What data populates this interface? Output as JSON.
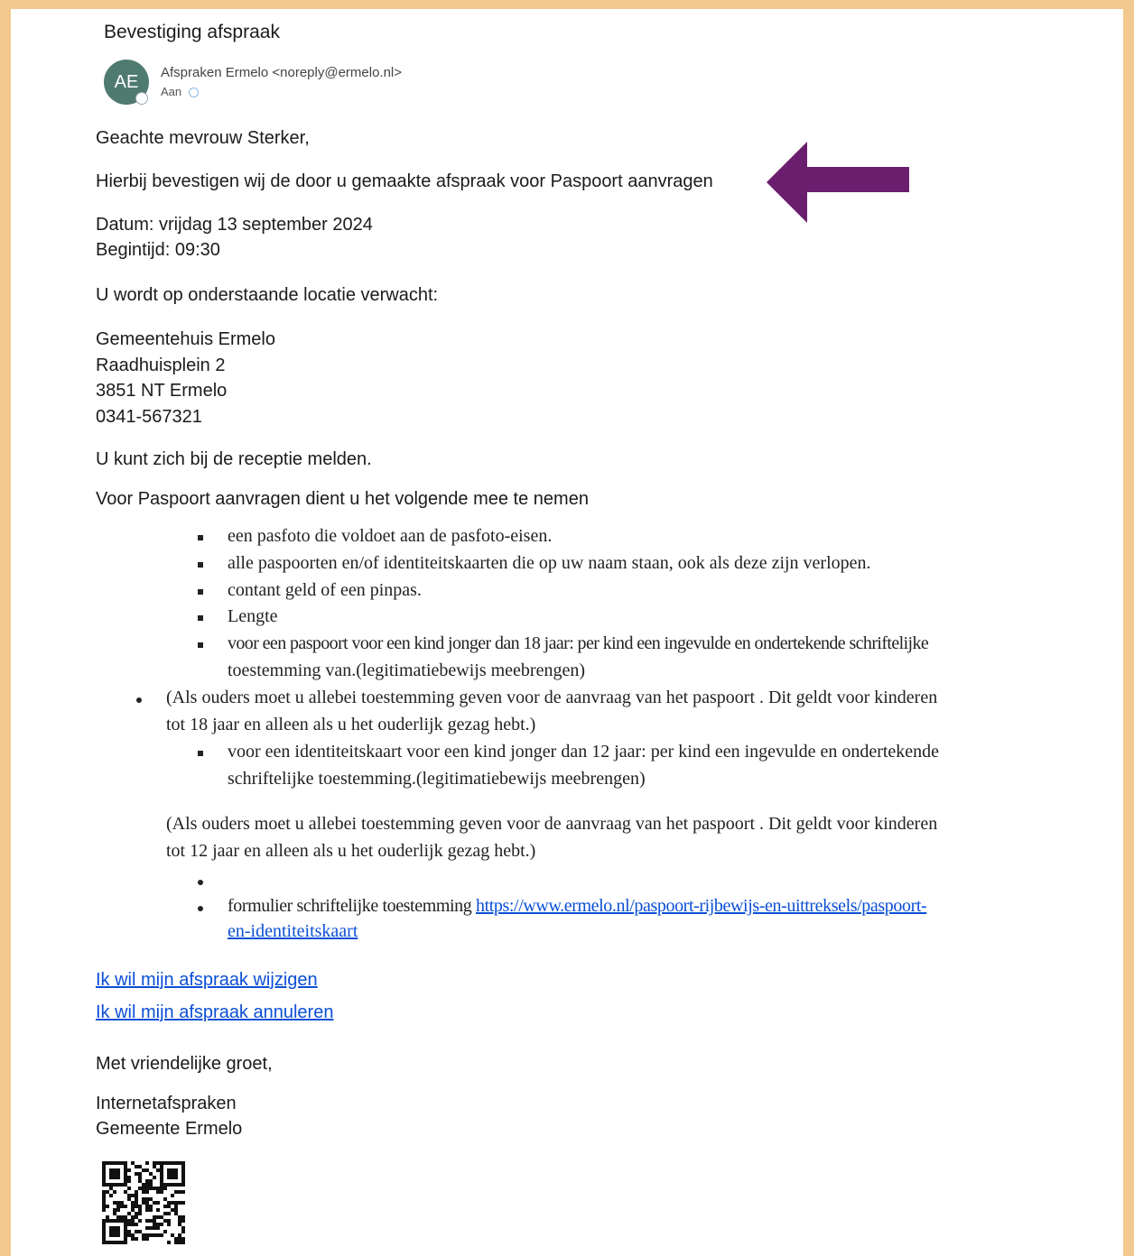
{
  "email": {
    "subject": "Bevestiging afspraak",
    "avatar_initials": "AE",
    "sender": "Afspraken Ermelo <noreply@ermelo.nl>",
    "to_label": "Aan"
  },
  "body": {
    "greeting": "Geachte mevrouw Sterker,",
    "confirmation": "Hierbij bevestigen wij de door u gemaakte afspraak voor Paspoort aanvragen",
    "date": "Datum: vrijdag 13 september 2024",
    "start_time": "Begintijd: 09:30",
    "location_intro": "U wordt op onderstaande locatie verwacht:",
    "address": [
      "Gemeentehuis Ermelo",
      "Raadhuisplein 2",
      "3851 NT Ermelo",
      "0341-567321"
    ],
    "report": "U kunt zich bij de receptie melden.",
    "bring_intro": "Voor Paspoort aanvragen dient u het volgende mee te nemen",
    "items": [
      "een pasfoto die voldoet aan de pasfoto-eisen.",
      "alle paspoorten en/of identiteitskaarten die op uw naam staan, ook als deze zijn verlopen.",
      "contant geld of een pinpas.",
      "Lengte",
      "voor een paspoort voor een kind jonger dan 18 jaar: per kind een ingevulde en ondertekende schriftelijke",
      "toestemming van.(legitimatiebewijs meebrengen)"
    ],
    "parents_18": [
      "(Als ouders moet u allebei toestemming geven voor de aanvraag van het paspoort . Dit geldt voor kinderen",
      "tot 18 jaar en alleen als u  het ouderlijk gezag hebt.)"
    ],
    "id_card": [
      "voor een identiteitskaart voor een kind jonger dan 12 jaar: per kind een ingevulde en ondertekende",
      "schriftelijke toestemming.(legitimatiebewijs meebrengen)"
    ],
    "parents_12": [
      "(Als ouders moet u allebei toestemming geven voor de aanvraag van het paspoort . Dit geldt voor kinderen",
      "tot 12 jaar en alleen als u  het ouderlijk gezag hebt.)"
    ],
    "form_label": "formulier schriftelijke toestemming",
    "form_link": [
      "https://www.ermelo.nl/paspoort-rijbewijs-en-uittreksels/paspoort-",
      "en-identiteitskaart"
    ],
    "link_change": "Ik wil mijn afspraak wijzigen",
    "link_cancel": "Ik wil mijn afspraak annuleren",
    "closing": "Met vriendelijke groet,",
    "signature": [
      "Internetafspraken",
      "Gemeente Ermelo"
    ]
  },
  "colors": {
    "frame": "#f3c88e",
    "arrow": "#6a1e6e",
    "link": "#0b4fd6",
    "avatar": "#4f7a6f"
  },
  "icons": [
    "arrow-left-icon",
    "qr-code-icon",
    "presence-icon"
  ]
}
